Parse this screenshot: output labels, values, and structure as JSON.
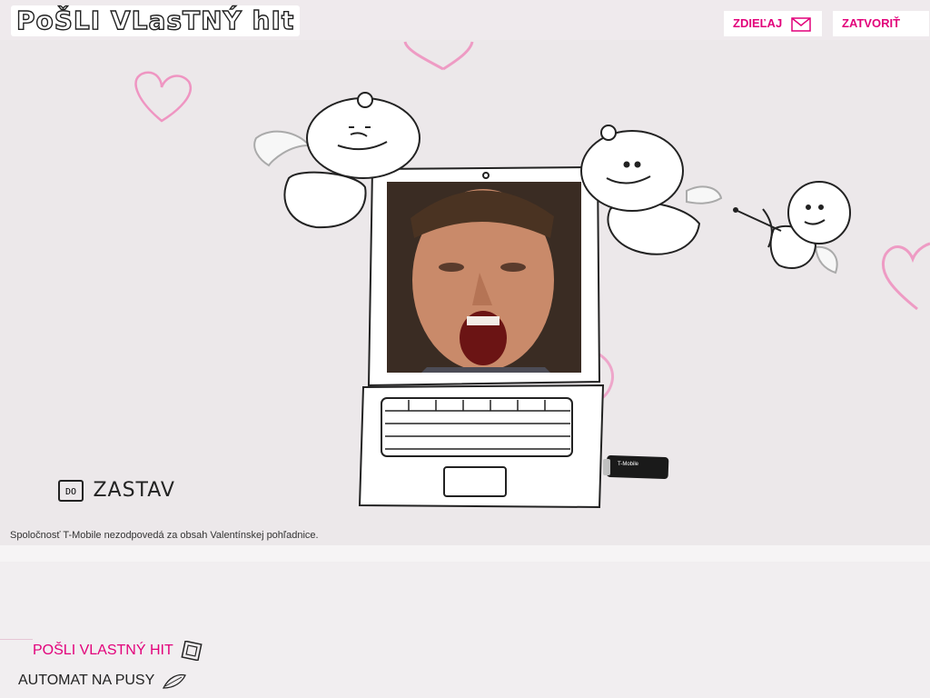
{
  "header": {
    "logo_text": "PoŠLI VLasTNÝ hIt",
    "share_label": "ZDIEĽAJ",
    "close_label": "ZATVORIŤ"
  },
  "stage": {
    "stop_icon_text": "DO",
    "stop_label": "ZASTAV",
    "disclaimer": "Spoločnosť T-Mobile nezodpovedá za obsah Valentínskej pohľadnice.",
    "modem_label": "T-Mobile"
  },
  "nav": {
    "item1": "POŠLI VLASTNÝ HIT",
    "item2": "AUTOMAT NA PUSY"
  },
  "colors": {
    "accent": "#e2007a",
    "heart": "#f07ab4"
  },
  "icons": {
    "share": "envelope-icon",
    "close": "x-icon",
    "nav1": "photo-card-icon",
    "nav2": "leaf-icon"
  }
}
